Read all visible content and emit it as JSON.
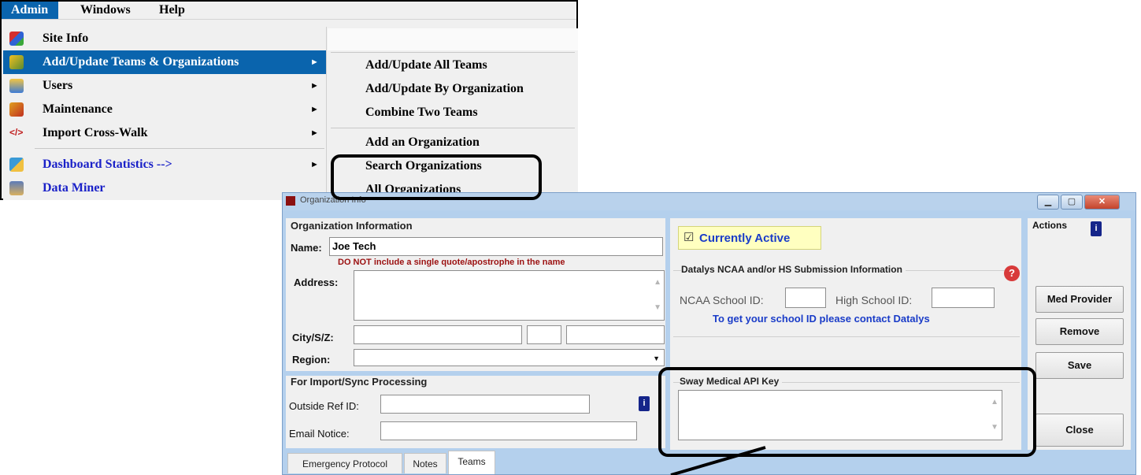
{
  "menubar": {
    "admin": "Admin",
    "windows": "Windows",
    "help": "Help"
  },
  "admin_menu": {
    "items": [
      {
        "label": "Site Info"
      },
      {
        "label": "Add/Update Teams & Organizations"
      },
      {
        "label": "Users"
      },
      {
        "label": "Maintenance"
      },
      {
        "label": "Import Cross-Walk"
      },
      {
        "label": "Dashboard Statistics -->"
      },
      {
        "label": "Data Miner"
      }
    ],
    "arrow": "►",
    "import_icon_text": "</>"
  },
  "submenu": {
    "items": [
      "Add/Update All Teams",
      "Add/Update By Organization",
      "Combine Two Teams",
      "Add an Organization",
      "Search Organizations",
      "All Organizations"
    ]
  },
  "org_window": {
    "title": "Organization Info",
    "minimize": "▁",
    "maximize": "▢",
    "close": "✕",
    "org_info_group": "Organization Information",
    "name_label": "Name:",
    "name_value": "Joe Tech",
    "name_warning": "DO NOT include a single quote/apostrophe in the name",
    "address_label": "Address:",
    "city_label": "City/S/Z:",
    "region_label": "Region:",
    "dropdown_arrow": "▼",
    "scroll_up": "▲",
    "scroll_down": "▼",
    "import_group": "For Import/Sync Processing",
    "outside_ref_label": "Outside Ref ID:",
    "email_notice_label": "Email Notice:",
    "currently_active": "Currently Active",
    "checkbox_mark": "☑",
    "datalys_group": "Datalys NCAA and/or HS Submission Information",
    "ncaa_label": "NCAA School ID:",
    "hs_label": "High School ID:",
    "datalys_note": "To get your school ID please contact Datalys",
    "help_icon_text": "?",
    "sway_group": "Sway Medical API Key",
    "actions_label": "Actions",
    "book_letter": "i",
    "buttons": {
      "med_provider": "Med Provider",
      "remove": "Remove",
      "save": "Save",
      "close": "Close"
    },
    "tabs": [
      "Emergency Protocol",
      "Notes",
      "Teams"
    ]
  }
}
